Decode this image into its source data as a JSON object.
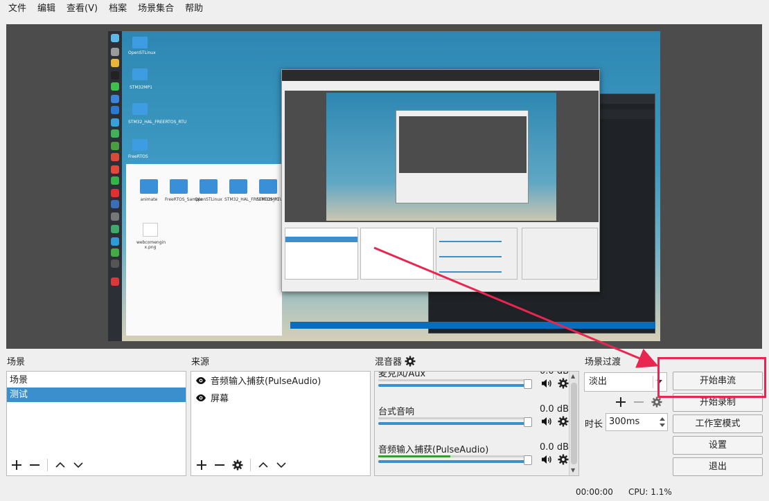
{
  "menu": [
    "文件",
    "编辑",
    "查看(V)",
    "档案",
    "场景集合",
    "帮助"
  ],
  "preview": {
    "desktop_icons": [
      "OpenSTLinux",
      "STM32MP1",
      "STM32_HAL_FREERTOS_RTU",
      "FreeRTOS"
    ],
    "folders": [
      "animate",
      "FreeRTOS_Sample",
      "OpenSTLinux",
      "STM32_HAL_FREERTOS_RTU",
      "STM32MP1"
    ],
    "file_image": "webcomengin\nx.png"
  },
  "scenes": {
    "title": "场景",
    "items": [
      "场景",
      "测试"
    ],
    "selected_index": 1
  },
  "sources": {
    "title": "来源",
    "items": [
      "音频输入捕获(PulseAudio)",
      "屏幕"
    ]
  },
  "mixer": {
    "title": "混音器",
    "channels": [
      {
        "name": "麦克风/Aux",
        "db": "0.0 dB",
        "level": 0.0
      },
      {
        "name": "台式音响",
        "db": "0.0 dB",
        "level": 0.0
      },
      {
        "name": "音频输入捕获(PulseAudio)",
        "db": "0.0 dB",
        "level": 0.49
      }
    ]
  },
  "transitions": {
    "title": "场景过渡",
    "selected": "淡出",
    "duration_label": "时长",
    "duration_value": "300ms"
  },
  "controls": {
    "start_streaming": "开始串流",
    "start_recording": "开始录制",
    "studio_mode": "工作室模式",
    "settings": "设置",
    "exit": "退出"
  },
  "status": {
    "time": "00:00:00",
    "cpu": "CPU: 1.1%"
  },
  "colors": {
    "accent": "#3b8fcc",
    "annotation": "#e8264f"
  }
}
